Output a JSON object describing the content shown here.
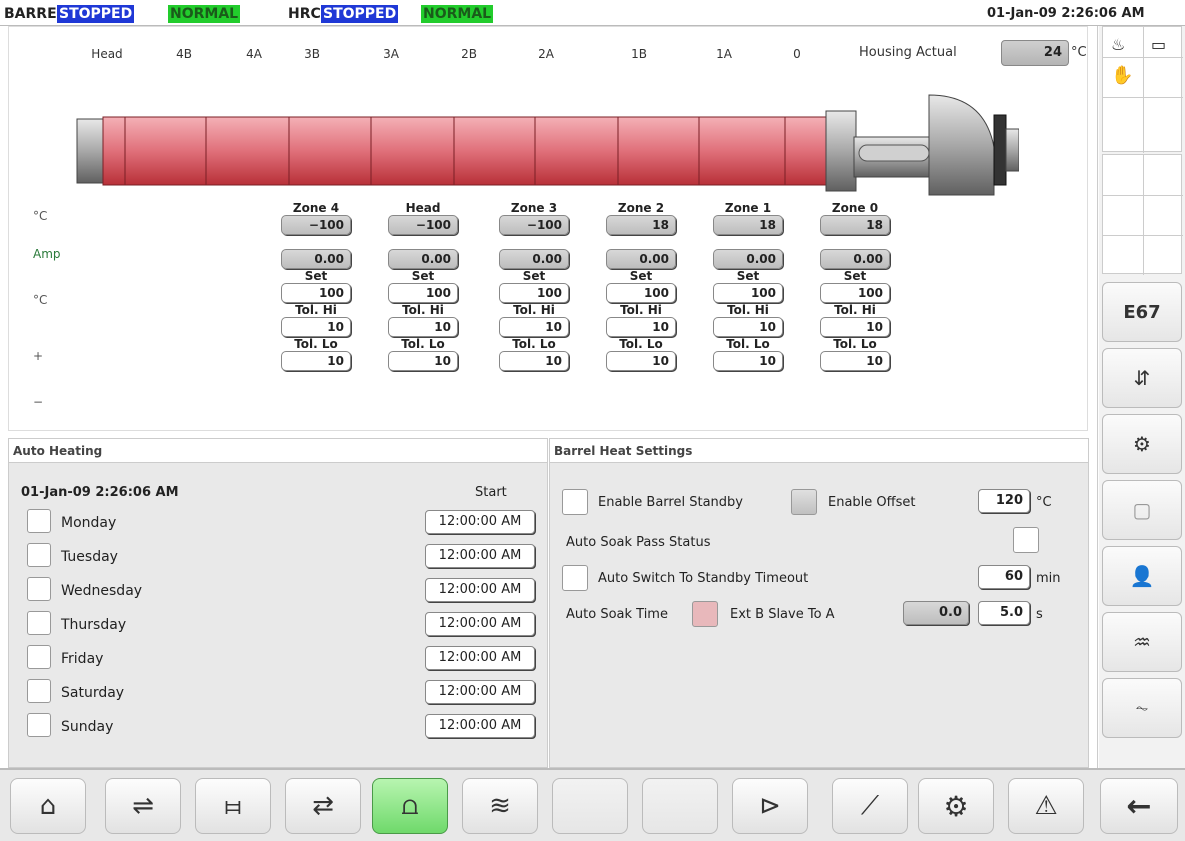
{
  "status": {
    "barrel_label": "BARREL",
    "barrel_state": "STOPPED",
    "barrel_mode": "NORMAL",
    "hrc_label": "HRC",
    "hrc_state": "STOPPED",
    "hrc_mode": "NORMAL",
    "datetime": "01-Jan-09 2:26:06 AM"
  },
  "barrel": {
    "zone_labels": [
      "Head",
      "4B",
      "4A",
      "3B",
      "3A",
      "2B",
      "2A",
      "1B",
      "1A",
      "0"
    ],
    "housing_label": "Housing Actual",
    "housing_value": "24",
    "housing_unit": "°C",
    "row_labels": [
      "°C",
      "Amp",
      "°C",
      "+",
      "−"
    ],
    "set_label": "Set",
    "tol_hi_label": "Tol. Hi",
    "tol_lo_label": "Tol. Lo",
    "zones": [
      {
        "name": "Zone 4",
        "actual": "−100",
        "amp": "0.00",
        "set": "100",
        "tol_hi": "10",
        "tol_lo": "10"
      },
      {
        "name": "Head",
        "actual": "−100",
        "amp": "0.00",
        "set": "100",
        "tol_hi": "10",
        "tol_lo": "10"
      },
      {
        "name": "Zone 3",
        "actual": "−100",
        "amp": "0.00",
        "set": "100",
        "tol_hi": "10",
        "tol_lo": "10"
      },
      {
        "name": "Zone 2",
        "actual": "18",
        "amp": "0.00",
        "set": "100",
        "tol_hi": "10",
        "tol_lo": "10"
      },
      {
        "name": "Zone 1",
        "actual": "18",
        "amp": "0.00",
        "set": "100",
        "tol_hi": "10",
        "tol_lo": "10"
      },
      {
        "name": "Zone 0",
        "actual": "18",
        "amp": "0.00",
        "set": "100",
        "tol_hi": "10",
        "tol_lo": "10"
      }
    ]
  },
  "auto_heating": {
    "title": "Auto Heating",
    "datetime": "01-Jan-09 2:26:06 AM",
    "start_label": "Start",
    "days": [
      {
        "name": "Monday",
        "start": "12:00:00 AM"
      },
      {
        "name": "Tuesday",
        "start": "12:00:00 AM"
      },
      {
        "name": "Wednesday",
        "start": "12:00:00 AM"
      },
      {
        "name": "Thursday",
        "start": "12:00:00 AM"
      },
      {
        "name": "Friday",
        "start": "12:00:00 AM"
      },
      {
        "name": "Saturday",
        "start": "12:00:00 AM"
      },
      {
        "name": "Sunday",
        "start": "12:00:00 AM"
      }
    ]
  },
  "barrel_heat": {
    "title": "Barrel Heat Settings",
    "enable_standby": "Enable Barrel Standby",
    "enable_offset": "Enable Offset",
    "offset_value": "120",
    "offset_unit": "°C",
    "soak_pass": "Auto Soak Pass Status",
    "standby_timeout": "Auto Switch To Standby Timeout",
    "standby_timeout_value": "60",
    "standby_timeout_unit": "min",
    "soak_time": "Auto Soak Time",
    "slave_label": "Ext B Slave To A",
    "soak_actual": "0.0",
    "soak_set": "5.0",
    "soak_unit": "s"
  },
  "sidebar": {
    "alarm_code": "E67"
  },
  "colors": {
    "status_blue": "#1f38d6",
    "status_green": "#22cc2c",
    "barrel_red": "#e0707a",
    "active_nav": "#6fd96b"
  }
}
